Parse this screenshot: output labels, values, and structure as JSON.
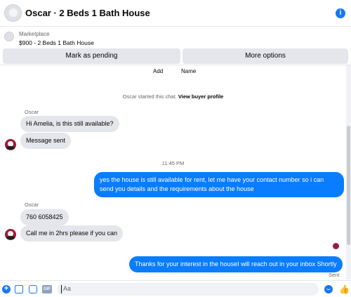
{
  "header": {
    "title": "Oscar · 2 Beds 1 Bath House",
    "info_icon": "info-icon"
  },
  "listing": {
    "source": "Marketplace",
    "name": "$900 - 2 Beds 1 Bath House"
  },
  "actions": {
    "pending_label": "Mark as pending",
    "more_label": "More options"
  },
  "thread": {
    "col_add": "Add",
    "col_name": "Name",
    "started_text": "Oscar started this chat.",
    "view_profile_label": "View buyer profile",
    "timestamp": "11:45 PM",
    "messages": [
      {
        "sender": "Oscar",
        "text": "Hi Amelia, is this still available?"
      },
      {
        "text": "Message sent"
      },
      {
        "text": "yes the house is still available for rent, let me have your contact number so i can send you details and the requirements about the house"
      },
      {
        "sender": "Oscar",
        "text": "760 6058425"
      },
      {
        "text": "Call me in 2hrs please if you can"
      },
      {
        "text": "Thanks for your interest in the houseI will reach out in your inbox Shortly"
      }
    ],
    "sent_status": "Sent"
  },
  "composer": {
    "placeholder": "Aa",
    "gif_label": "GIF"
  },
  "colors": {
    "accent": "#1877f2",
    "outgoing_bubble": "#0a7cff",
    "incoming_bubble": "#e4e6eb"
  }
}
